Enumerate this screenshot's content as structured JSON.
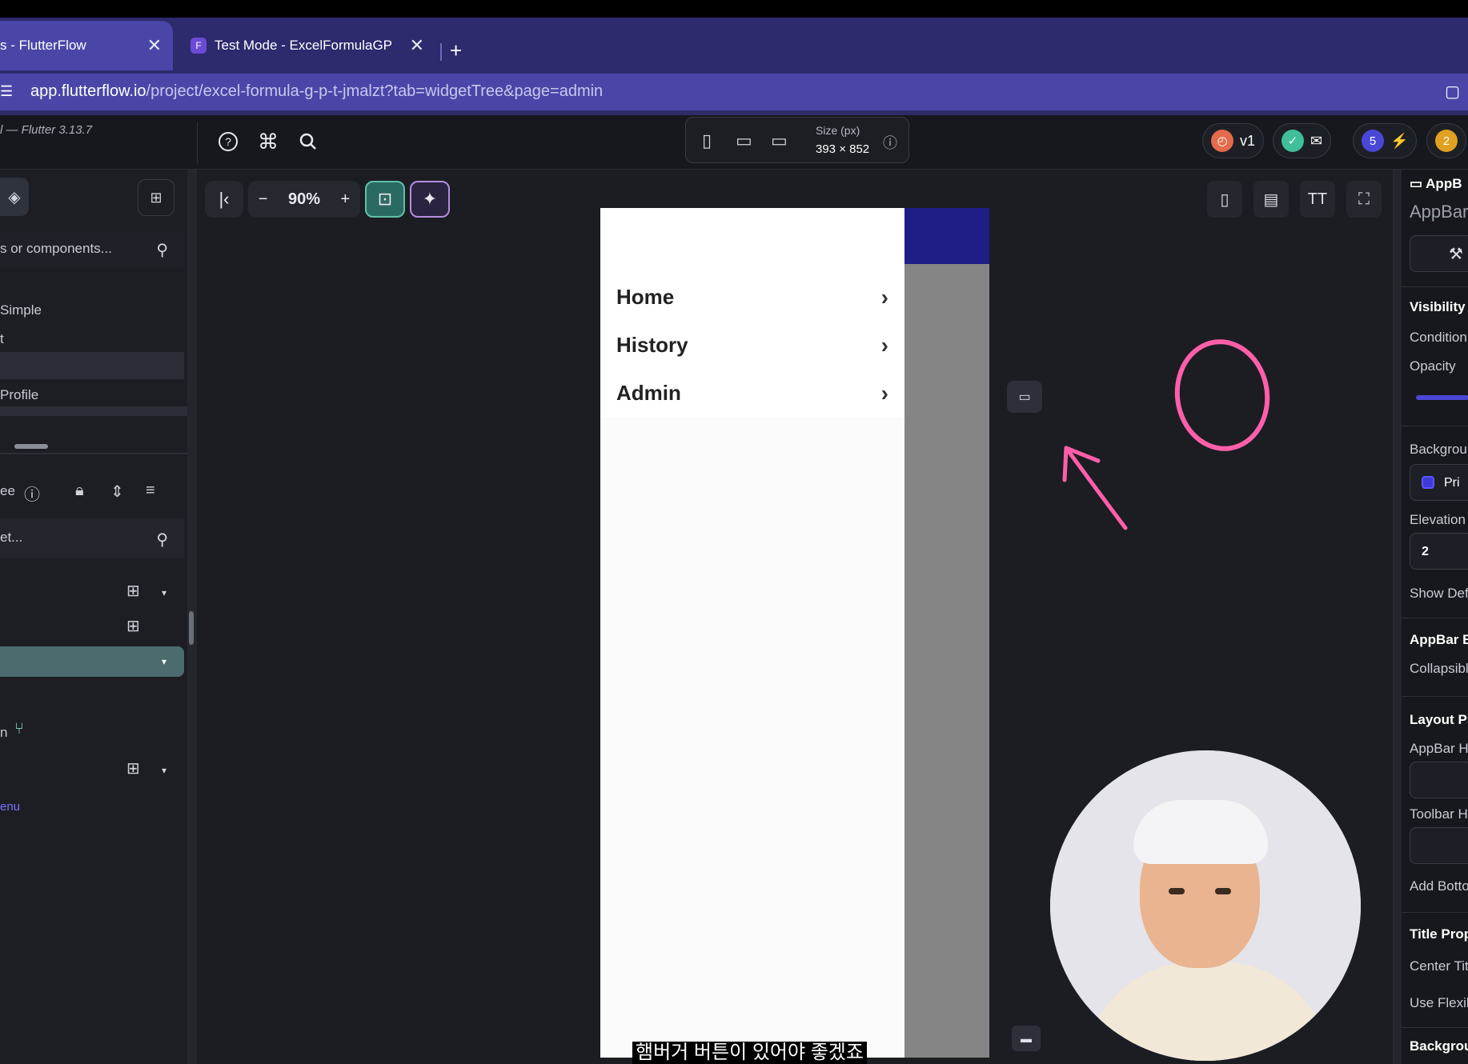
{
  "browser": {
    "tabs": [
      {
        "label": "s - FlutterFlow",
        "close": "✕"
      },
      {
        "label": "Test Mode - ExcelFormulaGP",
        "close": "✕"
      }
    ],
    "new_tab": "+",
    "url_host": "app.flutterflow.io",
    "url_path": "/project/excel-formula-g-p-t-jmalzt?tab=widgetTree&page=admin"
  },
  "toolbar": {
    "flutter_version": "l — Flutter 3.13.7",
    "size_label": "Size (px)",
    "size_value": "393 × 852",
    "version_label": "v1",
    "badge_count_1": "5",
    "badge_count_2": "2"
  },
  "left_panel": {
    "search_placeholder": "s or components...",
    "items": [
      "Simple",
      "t",
      "Profile"
    ],
    "tree_label": "ee",
    "tree_search_placeholder": "et...",
    "branch_label": "n",
    "menu_label": "enu"
  },
  "canvas": {
    "zoom_value": "90%",
    "zoom_minus": "−",
    "zoom_plus": "+"
  },
  "drawer": {
    "items": [
      "Home",
      "History",
      "Admin"
    ]
  },
  "right_panel": {
    "header": "AppB",
    "widget_name": "AppBar",
    "visibility": "Visibility",
    "condition": "Condition",
    "opacity": "Opacity",
    "background": "Backgrou",
    "background_value": "Pri",
    "elevation": "Elevation",
    "elevation_value": "2",
    "show_default": "Show Def",
    "appbar_behavior": "AppBar B",
    "collapsible": "Collapsibl",
    "layout_props": "Layout Pr",
    "appbar_height": "AppBar H",
    "toolbar_height": "Toolbar H",
    "add_bottom": "Add Botto",
    "title_props": "Title Prop",
    "center_title": "Center Tit",
    "use_flexible": "Use Flexib",
    "background2": "Backgrou"
  },
  "subtitle": "햄버거 버튼이 있어야 좋겠죠",
  "colors": {
    "accent": "#4a46a8",
    "annotation": "#ff5fa8",
    "appbar": "#1f1d86"
  }
}
